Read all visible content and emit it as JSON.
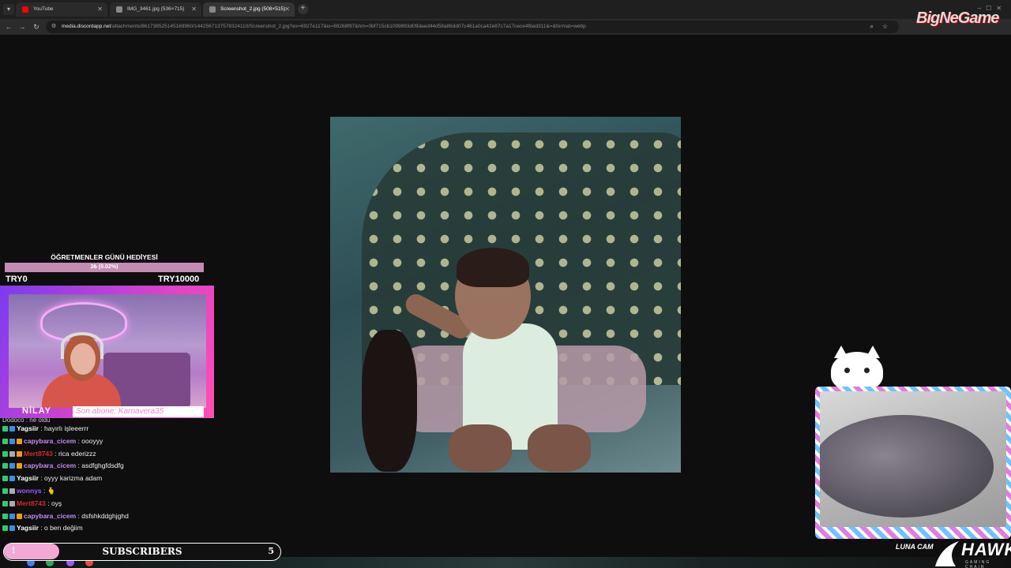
{
  "browser": {
    "tabs": [
      {
        "label": "YouTube",
        "favicon_color": "#ff0000",
        "active": false
      },
      {
        "label": "IMG_3461.jpg (536×715)",
        "favicon_color": "#888888",
        "active": false
      },
      {
        "label": "Screenshot_2.jpg (508×515)",
        "favicon_color": "#888888",
        "active": true
      }
    ],
    "url_host": "media.discordapp.net",
    "url_path": "/attachments/861738525145169960/1442567137578324110/Screenshot_2.jpg?ex=6927e117&is=69268f97&hm=0bf715cb1099893d09daed44d58a86dd07c461a0ca42e87c7a17cece4fbad311&=&format=webp",
    "logo_text": "BigNeGame"
  },
  "donation_goal": {
    "title": "ÖĞRETMENLER GÜNÜ HEDİYESİ",
    "progress_text": "2₺ (0.02%)",
    "progress_fraction": 0.0002,
    "min_label": "TRY0",
    "max_label": "TRY10000"
  },
  "webcam": {
    "name": "NİLAY",
    "last_sub": "Son abone: Karnavera35"
  },
  "chat": {
    "partial_top": "Dodoco : ne oldu",
    "messages": [
      {
        "user": "Yagsiir",
        "color": "#ffffff",
        "text": "hayırlı işleeerrr"
      },
      {
        "user": "capybara_cicem",
        "color": "#c28df5",
        "text": "oooyyy"
      },
      {
        "user": "Mert8743",
        "color": "#d62a2a",
        "text": "rica ederizzz"
      },
      {
        "user": "capybara_cicem",
        "color": "#c28df5",
        "text": "asdfghgfdsdfg"
      },
      {
        "user": "Yagsiir",
        "color": "#ffffff",
        "text": "oyyy karizma adam"
      },
      {
        "user": "wonnys",
        "color": "#9b59ff",
        "text": "🫰"
      },
      {
        "user": "Mert8743",
        "color": "#d62a2a",
        "text": "oyş"
      },
      {
        "user": "capybara_cicem",
        "color": "#c28df5",
        "text": "dsfshkddghjghd"
      },
      {
        "user": "Yagsiir",
        "color": "#ffffff",
        "text": "o ben değiim"
      }
    ]
  },
  "subscribers": {
    "label": "SUBSCRIBERS",
    "current": "1",
    "goal": "5",
    "progress_fraction": 0.2
  },
  "luna_cam": {
    "label": "LUNA CAM"
  },
  "sponsor": {
    "name": "HAWK",
    "tagline": "GAMING CHAIR"
  },
  "colors": {
    "accent_pink": "#e9a9d4",
    "overlay_purple": "#7a3cf0",
    "background": "#0e0e0e"
  }
}
